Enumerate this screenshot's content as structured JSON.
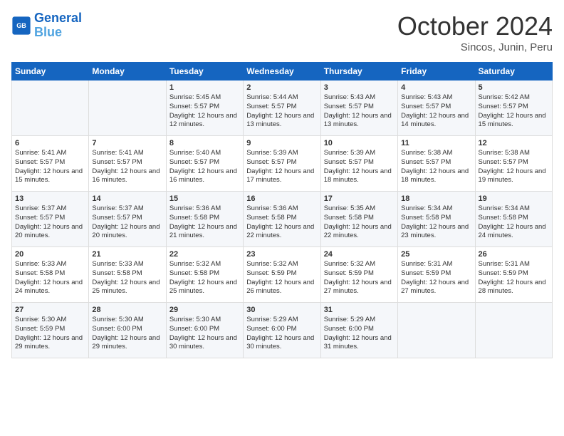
{
  "header": {
    "logo_line1": "General",
    "logo_line2": "Blue",
    "month_year": "October 2024",
    "location": "Sincos, Junin, Peru"
  },
  "weekdays": [
    "Sunday",
    "Monday",
    "Tuesday",
    "Wednesday",
    "Thursday",
    "Friday",
    "Saturday"
  ],
  "weeks": [
    [
      {
        "day": "",
        "info": ""
      },
      {
        "day": "",
        "info": ""
      },
      {
        "day": "1",
        "info": "Sunrise: 5:45 AM\nSunset: 5:57 PM\nDaylight: 12 hours and 12 minutes."
      },
      {
        "day": "2",
        "info": "Sunrise: 5:44 AM\nSunset: 5:57 PM\nDaylight: 12 hours and 13 minutes."
      },
      {
        "day": "3",
        "info": "Sunrise: 5:43 AM\nSunset: 5:57 PM\nDaylight: 12 hours and 13 minutes."
      },
      {
        "day": "4",
        "info": "Sunrise: 5:43 AM\nSunset: 5:57 PM\nDaylight: 12 hours and 14 minutes."
      },
      {
        "day": "5",
        "info": "Sunrise: 5:42 AM\nSunset: 5:57 PM\nDaylight: 12 hours and 15 minutes."
      }
    ],
    [
      {
        "day": "6",
        "info": "Sunrise: 5:41 AM\nSunset: 5:57 PM\nDaylight: 12 hours and 15 minutes."
      },
      {
        "day": "7",
        "info": "Sunrise: 5:41 AM\nSunset: 5:57 PM\nDaylight: 12 hours and 16 minutes."
      },
      {
        "day": "8",
        "info": "Sunrise: 5:40 AM\nSunset: 5:57 PM\nDaylight: 12 hours and 16 minutes."
      },
      {
        "day": "9",
        "info": "Sunrise: 5:39 AM\nSunset: 5:57 PM\nDaylight: 12 hours and 17 minutes."
      },
      {
        "day": "10",
        "info": "Sunrise: 5:39 AM\nSunset: 5:57 PM\nDaylight: 12 hours and 18 minutes."
      },
      {
        "day": "11",
        "info": "Sunrise: 5:38 AM\nSunset: 5:57 PM\nDaylight: 12 hours and 18 minutes."
      },
      {
        "day": "12",
        "info": "Sunrise: 5:38 AM\nSunset: 5:57 PM\nDaylight: 12 hours and 19 minutes."
      }
    ],
    [
      {
        "day": "13",
        "info": "Sunrise: 5:37 AM\nSunset: 5:57 PM\nDaylight: 12 hours and 20 minutes."
      },
      {
        "day": "14",
        "info": "Sunrise: 5:37 AM\nSunset: 5:57 PM\nDaylight: 12 hours and 20 minutes."
      },
      {
        "day": "15",
        "info": "Sunrise: 5:36 AM\nSunset: 5:58 PM\nDaylight: 12 hours and 21 minutes."
      },
      {
        "day": "16",
        "info": "Sunrise: 5:36 AM\nSunset: 5:58 PM\nDaylight: 12 hours and 22 minutes."
      },
      {
        "day": "17",
        "info": "Sunrise: 5:35 AM\nSunset: 5:58 PM\nDaylight: 12 hours and 22 minutes."
      },
      {
        "day": "18",
        "info": "Sunrise: 5:34 AM\nSunset: 5:58 PM\nDaylight: 12 hours and 23 minutes."
      },
      {
        "day": "19",
        "info": "Sunrise: 5:34 AM\nSunset: 5:58 PM\nDaylight: 12 hours and 24 minutes."
      }
    ],
    [
      {
        "day": "20",
        "info": "Sunrise: 5:33 AM\nSunset: 5:58 PM\nDaylight: 12 hours and 24 minutes."
      },
      {
        "day": "21",
        "info": "Sunrise: 5:33 AM\nSunset: 5:58 PM\nDaylight: 12 hours and 25 minutes."
      },
      {
        "day": "22",
        "info": "Sunrise: 5:32 AM\nSunset: 5:58 PM\nDaylight: 12 hours and 25 minutes."
      },
      {
        "day": "23",
        "info": "Sunrise: 5:32 AM\nSunset: 5:59 PM\nDaylight: 12 hours and 26 minutes."
      },
      {
        "day": "24",
        "info": "Sunrise: 5:32 AM\nSunset: 5:59 PM\nDaylight: 12 hours and 27 minutes."
      },
      {
        "day": "25",
        "info": "Sunrise: 5:31 AM\nSunset: 5:59 PM\nDaylight: 12 hours and 27 minutes."
      },
      {
        "day": "26",
        "info": "Sunrise: 5:31 AM\nSunset: 5:59 PM\nDaylight: 12 hours and 28 minutes."
      }
    ],
    [
      {
        "day": "27",
        "info": "Sunrise: 5:30 AM\nSunset: 5:59 PM\nDaylight: 12 hours and 29 minutes."
      },
      {
        "day": "28",
        "info": "Sunrise: 5:30 AM\nSunset: 6:00 PM\nDaylight: 12 hours and 29 minutes."
      },
      {
        "day": "29",
        "info": "Sunrise: 5:30 AM\nSunset: 6:00 PM\nDaylight: 12 hours and 30 minutes."
      },
      {
        "day": "30",
        "info": "Sunrise: 5:29 AM\nSunset: 6:00 PM\nDaylight: 12 hours and 30 minutes."
      },
      {
        "day": "31",
        "info": "Sunrise: 5:29 AM\nSunset: 6:00 PM\nDaylight: 12 hours and 31 minutes."
      },
      {
        "day": "",
        "info": ""
      },
      {
        "day": "",
        "info": ""
      }
    ]
  ]
}
